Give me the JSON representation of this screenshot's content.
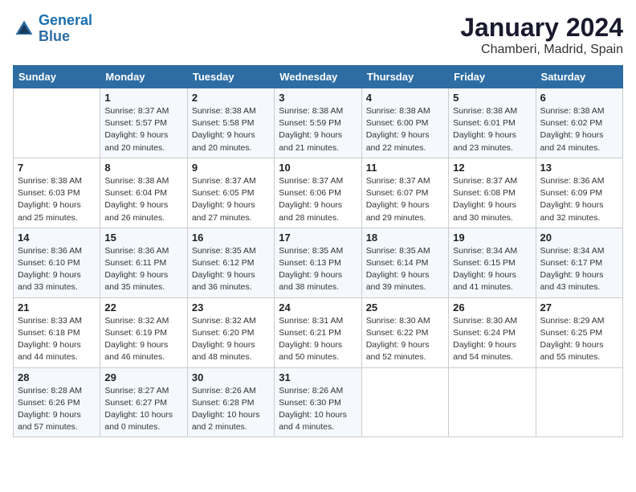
{
  "logo": {
    "line1": "General",
    "line2": "Blue"
  },
  "title": "January 2024",
  "location": "Chamberi, Madrid, Spain",
  "headers": [
    "Sunday",
    "Monday",
    "Tuesday",
    "Wednesday",
    "Thursday",
    "Friday",
    "Saturday"
  ],
  "weeks": [
    [
      {
        "day": "",
        "sunrise": "",
        "sunset": "",
        "daylight": ""
      },
      {
        "day": "1",
        "sunrise": "Sunrise: 8:37 AM",
        "sunset": "Sunset: 5:57 PM",
        "daylight": "Daylight: 9 hours and 20 minutes."
      },
      {
        "day": "2",
        "sunrise": "Sunrise: 8:38 AM",
        "sunset": "Sunset: 5:58 PM",
        "daylight": "Daylight: 9 hours and 20 minutes."
      },
      {
        "day": "3",
        "sunrise": "Sunrise: 8:38 AM",
        "sunset": "Sunset: 5:59 PM",
        "daylight": "Daylight: 9 hours and 21 minutes."
      },
      {
        "day": "4",
        "sunrise": "Sunrise: 8:38 AM",
        "sunset": "Sunset: 6:00 PM",
        "daylight": "Daylight: 9 hours and 22 minutes."
      },
      {
        "day": "5",
        "sunrise": "Sunrise: 8:38 AM",
        "sunset": "Sunset: 6:01 PM",
        "daylight": "Daylight: 9 hours and 23 minutes."
      },
      {
        "day": "6",
        "sunrise": "Sunrise: 8:38 AM",
        "sunset": "Sunset: 6:02 PM",
        "daylight": "Daylight: 9 hours and 24 minutes."
      }
    ],
    [
      {
        "day": "7",
        "sunrise": "Sunrise: 8:38 AM",
        "sunset": "Sunset: 6:03 PM",
        "daylight": "Daylight: 9 hours and 25 minutes."
      },
      {
        "day": "8",
        "sunrise": "Sunrise: 8:38 AM",
        "sunset": "Sunset: 6:04 PM",
        "daylight": "Daylight: 9 hours and 26 minutes."
      },
      {
        "day": "9",
        "sunrise": "Sunrise: 8:37 AM",
        "sunset": "Sunset: 6:05 PM",
        "daylight": "Daylight: 9 hours and 27 minutes."
      },
      {
        "day": "10",
        "sunrise": "Sunrise: 8:37 AM",
        "sunset": "Sunset: 6:06 PM",
        "daylight": "Daylight: 9 hours and 28 minutes."
      },
      {
        "day": "11",
        "sunrise": "Sunrise: 8:37 AM",
        "sunset": "Sunset: 6:07 PM",
        "daylight": "Daylight: 9 hours and 29 minutes."
      },
      {
        "day": "12",
        "sunrise": "Sunrise: 8:37 AM",
        "sunset": "Sunset: 6:08 PM",
        "daylight": "Daylight: 9 hours and 30 minutes."
      },
      {
        "day": "13",
        "sunrise": "Sunrise: 8:36 AM",
        "sunset": "Sunset: 6:09 PM",
        "daylight": "Daylight: 9 hours and 32 minutes."
      }
    ],
    [
      {
        "day": "14",
        "sunrise": "Sunrise: 8:36 AM",
        "sunset": "Sunset: 6:10 PM",
        "daylight": "Daylight: 9 hours and 33 minutes."
      },
      {
        "day": "15",
        "sunrise": "Sunrise: 8:36 AM",
        "sunset": "Sunset: 6:11 PM",
        "daylight": "Daylight: 9 hours and 35 minutes."
      },
      {
        "day": "16",
        "sunrise": "Sunrise: 8:35 AM",
        "sunset": "Sunset: 6:12 PM",
        "daylight": "Daylight: 9 hours and 36 minutes."
      },
      {
        "day": "17",
        "sunrise": "Sunrise: 8:35 AM",
        "sunset": "Sunset: 6:13 PM",
        "daylight": "Daylight: 9 hours and 38 minutes."
      },
      {
        "day": "18",
        "sunrise": "Sunrise: 8:35 AM",
        "sunset": "Sunset: 6:14 PM",
        "daylight": "Daylight: 9 hours and 39 minutes."
      },
      {
        "day": "19",
        "sunrise": "Sunrise: 8:34 AM",
        "sunset": "Sunset: 6:15 PM",
        "daylight": "Daylight: 9 hours and 41 minutes."
      },
      {
        "day": "20",
        "sunrise": "Sunrise: 8:34 AM",
        "sunset": "Sunset: 6:17 PM",
        "daylight": "Daylight: 9 hours and 43 minutes."
      }
    ],
    [
      {
        "day": "21",
        "sunrise": "Sunrise: 8:33 AM",
        "sunset": "Sunset: 6:18 PM",
        "daylight": "Daylight: 9 hours and 44 minutes."
      },
      {
        "day": "22",
        "sunrise": "Sunrise: 8:32 AM",
        "sunset": "Sunset: 6:19 PM",
        "daylight": "Daylight: 9 hours and 46 minutes."
      },
      {
        "day": "23",
        "sunrise": "Sunrise: 8:32 AM",
        "sunset": "Sunset: 6:20 PM",
        "daylight": "Daylight: 9 hours and 48 minutes."
      },
      {
        "day": "24",
        "sunrise": "Sunrise: 8:31 AM",
        "sunset": "Sunset: 6:21 PM",
        "daylight": "Daylight: 9 hours and 50 minutes."
      },
      {
        "day": "25",
        "sunrise": "Sunrise: 8:30 AM",
        "sunset": "Sunset: 6:22 PM",
        "daylight": "Daylight: 9 hours and 52 minutes."
      },
      {
        "day": "26",
        "sunrise": "Sunrise: 8:30 AM",
        "sunset": "Sunset: 6:24 PM",
        "daylight": "Daylight: 9 hours and 54 minutes."
      },
      {
        "day": "27",
        "sunrise": "Sunrise: 8:29 AM",
        "sunset": "Sunset: 6:25 PM",
        "daylight": "Daylight: 9 hours and 55 minutes."
      }
    ],
    [
      {
        "day": "28",
        "sunrise": "Sunrise: 8:28 AM",
        "sunset": "Sunset: 6:26 PM",
        "daylight": "Daylight: 9 hours and 57 minutes."
      },
      {
        "day": "29",
        "sunrise": "Sunrise: 8:27 AM",
        "sunset": "Sunset: 6:27 PM",
        "daylight": "Daylight: 10 hours and 0 minutes."
      },
      {
        "day": "30",
        "sunrise": "Sunrise: 8:26 AM",
        "sunset": "Sunset: 6:28 PM",
        "daylight": "Daylight: 10 hours and 2 minutes."
      },
      {
        "day": "31",
        "sunrise": "Sunrise: 8:26 AM",
        "sunset": "Sunset: 6:30 PM",
        "daylight": "Daylight: 10 hours and 4 minutes."
      },
      {
        "day": "",
        "sunrise": "",
        "sunset": "",
        "daylight": ""
      },
      {
        "day": "",
        "sunrise": "",
        "sunset": "",
        "daylight": ""
      },
      {
        "day": "",
        "sunrise": "",
        "sunset": "",
        "daylight": ""
      }
    ]
  ]
}
